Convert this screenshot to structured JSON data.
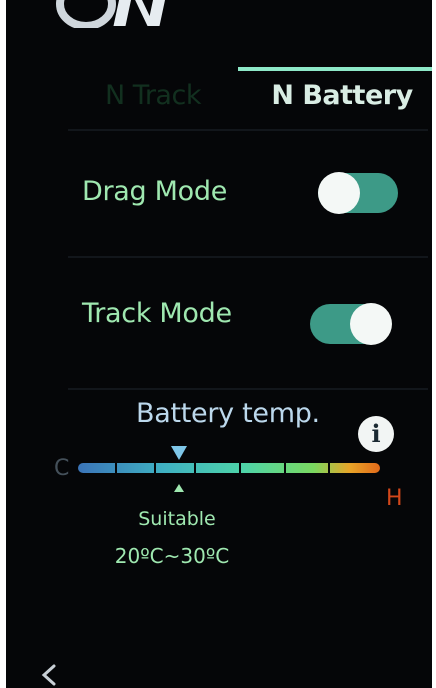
{
  "header": {
    "logo_icon": "n-brand-logo-icon"
  },
  "tabs": [
    {
      "label": "N Track",
      "active": false
    },
    {
      "label": "N Battery",
      "active": true
    }
  ],
  "settings": {
    "drag_mode": {
      "label": "Drag Mode",
      "enabled": false
    },
    "track_mode": {
      "label": "Track Mode",
      "enabled": true
    }
  },
  "battery_temp": {
    "title": "Battery temp.",
    "info_icon": "info-icon",
    "cold_label": "C",
    "hot_label": "H",
    "suitable_label": "Suitable",
    "suitable_range": "20ºC~30ºC"
  },
  "nav": {
    "back_icon": "chevron-left-icon"
  },
  "colors": {
    "background": "#050608",
    "accent": "#8ee8c8",
    "toggle_track": "#3d9a87",
    "label_green": "#9fe8b0",
    "hot": "#e26a1a",
    "cold": "#3b74b8"
  }
}
